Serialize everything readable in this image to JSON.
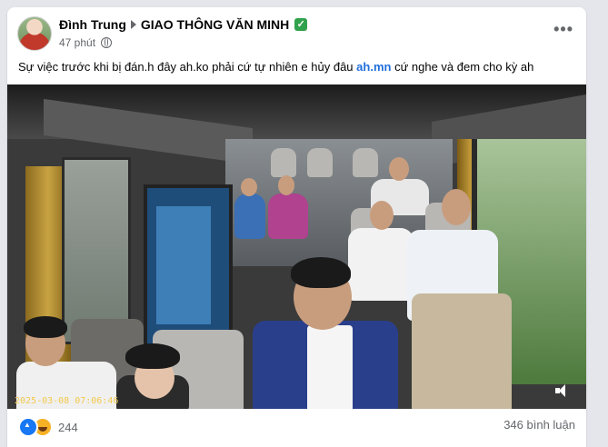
{
  "post": {
    "author": "Đình Trung",
    "group": "GIAO THÔNG VĂN MINH",
    "time": "47 phút",
    "text_before": "Sự việc trước khi bị đán.h đây ah.ko phải cứ tự nhiên e hủy đâu ",
    "link_text": "ah.mn",
    "text_after": " cứ nghe và đem cho kỳ ah",
    "more_label": "•••"
  },
  "media": {
    "timestamp": "2025-03-08 07:06:46",
    "description_icon": "speaker-icon"
  },
  "footer": {
    "reaction_count": "244",
    "comments": "346 bình luận",
    "reaction_icons": [
      "like-icon",
      "haha-icon"
    ]
  },
  "colors": {
    "link": "#216fdb",
    "verified": "#31a24c",
    "like": "#1877f2",
    "haha": "#f7b125"
  }
}
